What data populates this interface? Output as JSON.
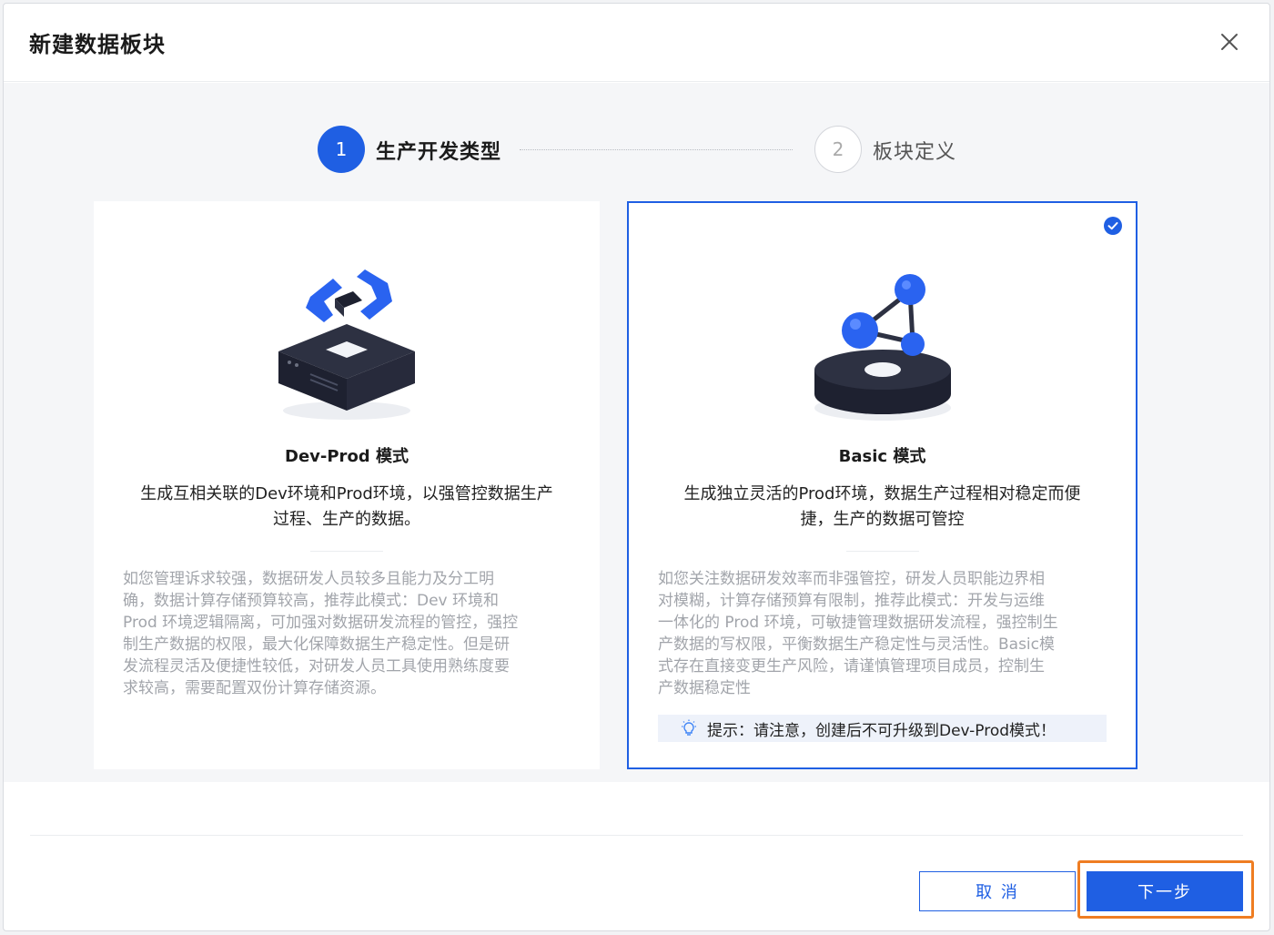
{
  "dialog": {
    "title": "新建数据板块",
    "close_icon": "close-icon"
  },
  "steps": [
    {
      "number": "1",
      "label": "生产开发类型",
      "active": true
    },
    {
      "number": "2",
      "label": "板块定义",
      "active": false
    }
  ],
  "cards": {
    "dev_prod": {
      "title": "Dev-Prod 模式",
      "desc_line1": "生成互相关联的Dev环境和Prod环境，以强管控数据生产",
      "desc_line2": "过程、生产的数据。",
      "detail_lines": [
        "如您管理诉求较强，数据研发人员较多且能力及分工明",
        "确，数据计算存储预算较高，推荐此模式：Dev 环境和",
        "Prod 环境逻辑隔离，可加强对数据研发流程的管控，强控",
        "制生产数据的权限，最大化保障数据生产稳定性。但是研",
        "发流程灵活及便捷性较低，对研发人员工具使用熟练度要",
        "求较高，需要配置双份计算存储资源。"
      ],
      "selected": false
    },
    "basic": {
      "title": "Basic 模式",
      "desc_line1": "生成独立灵活的Prod环境，数据生产过程相对稳定而便",
      "desc_line2": "捷，生产的数据可管控",
      "detail_lines": [
        "如您关注数据研发效率而非强管控，研发人员职能边界相",
        "对模糊，计算存储预算有限制，推荐此模式：开发与运维",
        "一体化的 Prod 环境，可敏捷管理数据研发流程，强控制生",
        "产数据的写权限，平衡数据生产稳定性与灵活性。Basic模",
        "式存在直接变更生产风险，请谨慎管理项目成员，控制生",
        "产数据稳定性"
      ],
      "tip": "提示：请注意，创建后不可升级到Dev-Prod模式！",
      "selected": true
    }
  },
  "footer": {
    "cancel_label": "取 消",
    "next_label": "下一步"
  },
  "colors": {
    "primary": "#1f5fe3",
    "highlight": "#ef7d22"
  }
}
